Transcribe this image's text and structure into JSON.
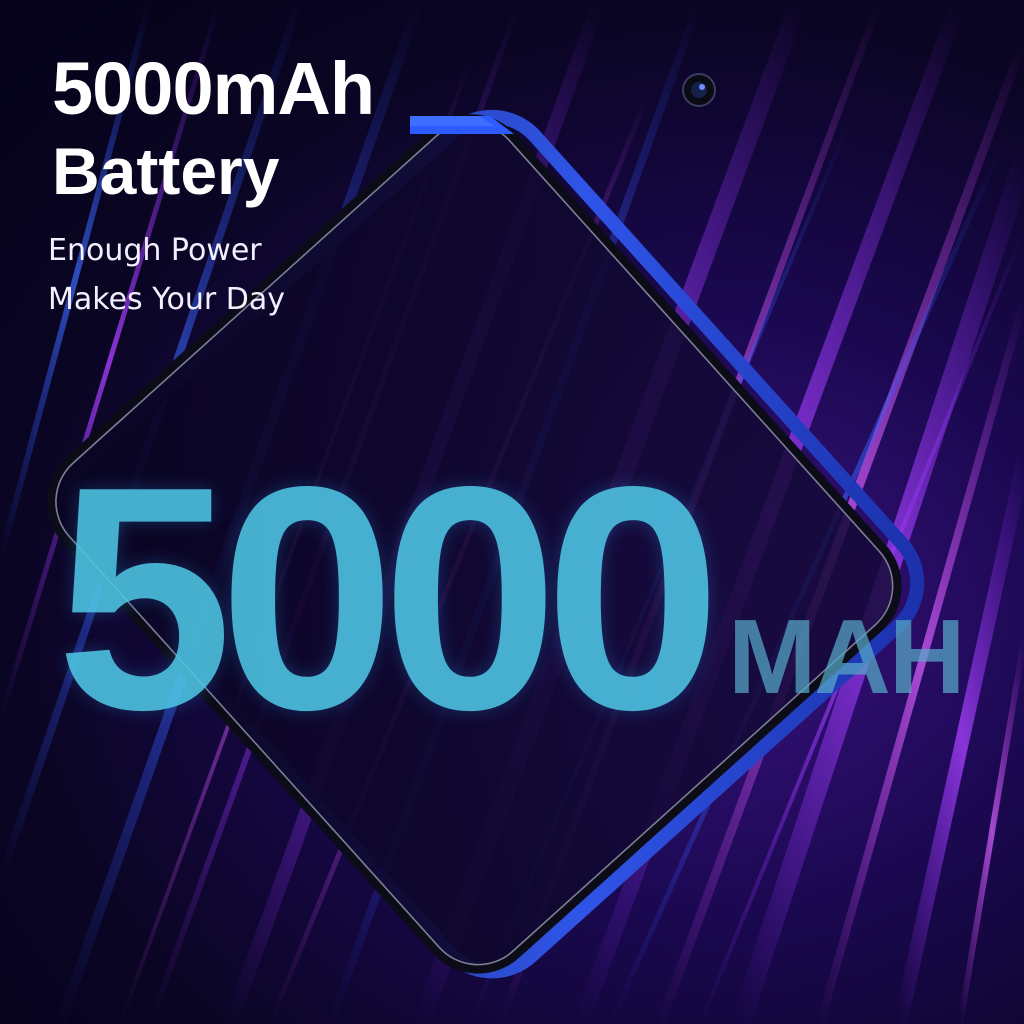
{
  "headline": "5000mAh",
  "subheadline": "Battery",
  "tagline": {
    "line1": "Enough Power",
    "line2": "Makes Your Day"
  },
  "hero": {
    "number": "5000",
    "unit": "MAH"
  },
  "colors": {
    "background": "#0a0522",
    "streak_purple": "#8a2be2",
    "streak_blue": "#2d5bff",
    "headline_text": "#ffffff",
    "hero_number": "#4fc7e6",
    "hero_unit": "#58a9c8",
    "phone_frame": "#2a4bd8"
  },
  "icons": [
    "front-camera-icon"
  ]
}
